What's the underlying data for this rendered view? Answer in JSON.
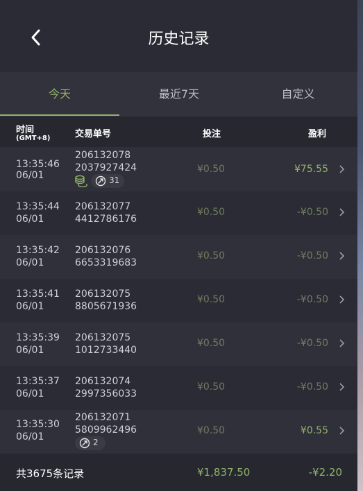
{
  "header": {
    "title": "历史记录"
  },
  "tabs": [
    {
      "label": "今天",
      "active": true
    },
    {
      "label": "最近7天",
      "active": false
    },
    {
      "label": "自定义",
      "active": false
    }
  ],
  "columns": {
    "time": "时间",
    "timezone": "(GMT+8)",
    "order": "交易单号",
    "bet": "投注",
    "profit": "盈利"
  },
  "rows": [
    {
      "time": "13:35:46",
      "date": "06/01",
      "order_a": "206132078",
      "order_b": "2037927424",
      "bet": "¥0.50",
      "profit": "¥75.55",
      "win": true,
      "coins": true,
      "free_spins": "31"
    },
    {
      "time": "13:35:44",
      "date": "06/01",
      "order_a": "206132077",
      "order_b": "4412786176",
      "bet": "¥0.50",
      "profit": "-¥0.50",
      "win": false
    },
    {
      "time": "13:35:42",
      "date": "06/01",
      "order_a": "206132076",
      "order_b": "6653319683",
      "bet": "¥0.50",
      "profit": "-¥0.50",
      "win": false
    },
    {
      "time": "13:35:41",
      "date": "06/01",
      "order_a": "206132075",
      "order_b": "8805671936",
      "bet": "¥0.50",
      "profit": "-¥0.50",
      "win": false
    },
    {
      "time": "13:35:39",
      "date": "06/01",
      "order_a": "206132075",
      "order_b": "1012733440",
      "bet": "¥0.50",
      "profit": "-¥0.50",
      "win": false
    },
    {
      "time": "13:35:37",
      "date": "06/01",
      "order_a": "206132074",
      "order_b": "2997356033",
      "bet": "¥0.50",
      "profit": "-¥0.50",
      "win": false
    },
    {
      "time": "13:35:30",
      "date": "06/01",
      "order_a": "206132071",
      "order_b": "5809962496",
      "bet": "¥0.50",
      "profit": "¥0.55",
      "win": true,
      "free_spins": "2"
    }
  ],
  "footer": {
    "count": "共3675条记录",
    "total_bet": "¥1,837.50",
    "total_profit": "-¥2.20"
  },
  "colors": {
    "accent": "#93b36a",
    "background": "#2b2b35"
  }
}
